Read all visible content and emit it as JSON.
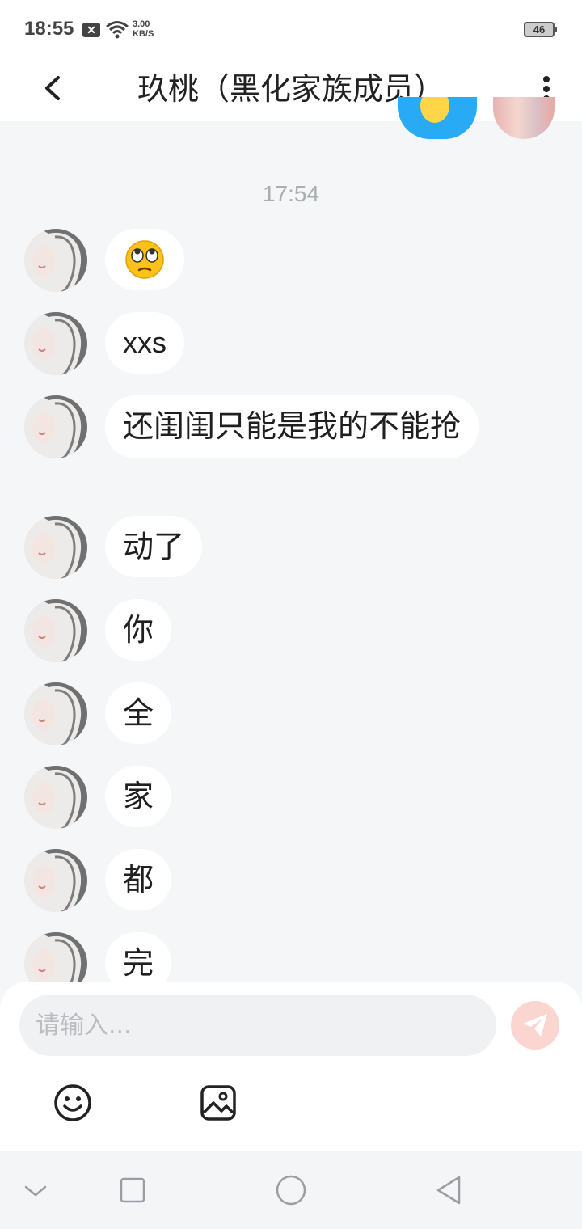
{
  "status_bar": {
    "time": "18:55",
    "notification_badge": "✕",
    "speed_value": "3.00",
    "speed_unit": "KB/S",
    "battery": "46"
  },
  "header": {
    "title": "玖桃（黑化家族成员）",
    "back_icon": "chevron-left-icon",
    "more_icon": "vertical-dots-icon"
  },
  "conversation": {
    "timestamp": "17:54",
    "messages": [
      {
        "type": "emoji",
        "emoji": "face-with-rolling-eyes"
      },
      {
        "type": "text",
        "text": "xxs"
      },
      {
        "type": "text",
        "text": "还闺闺只能是我的不能抢"
      },
      {
        "type": "text",
        "text": "动了"
      },
      {
        "type": "text",
        "text": "你"
      },
      {
        "type": "text",
        "text": "全"
      },
      {
        "type": "text",
        "text": "家"
      },
      {
        "type": "text",
        "text": "都"
      },
      {
        "type": "text",
        "text": "完"
      }
    ]
  },
  "composer": {
    "placeholder": "请输入...",
    "value": "",
    "send_icon": "paper-plane-icon",
    "emoji_icon": "smiley-icon",
    "image_icon": "image-icon"
  },
  "colors": {
    "accent_blue": "#29aaf4",
    "send_button": "#fbd5d0",
    "background": "#f4f6f8",
    "bubble": "#ffffff"
  }
}
